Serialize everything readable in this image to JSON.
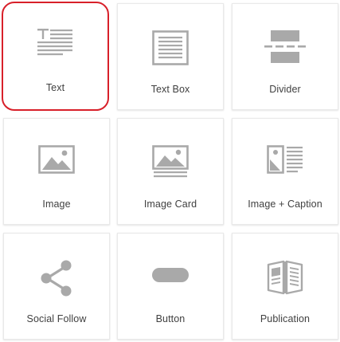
{
  "blocks": [
    {
      "label": "Text",
      "icon": "text-icon",
      "selected": true
    },
    {
      "label": "Text Box",
      "icon": "text-box-icon",
      "selected": false
    },
    {
      "label": "Divider",
      "icon": "divider-icon",
      "selected": false
    },
    {
      "label": "Image",
      "icon": "image-icon",
      "selected": false
    },
    {
      "label": "Image Card",
      "icon": "image-card-icon",
      "selected": false
    },
    {
      "label": "Image + Caption",
      "icon": "image-caption-icon",
      "selected": false
    },
    {
      "label": "Social Follow",
      "icon": "share-icon",
      "selected": false
    },
    {
      "label": "Button",
      "icon": "button-icon",
      "selected": false
    },
    {
      "label": "Publication",
      "icon": "publication-icon",
      "selected": false
    }
  ],
  "colors": {
    "icon": "#a9a9a9",
    "selected_border": "#d8202a",
    "label": "#404040"
  }
}
